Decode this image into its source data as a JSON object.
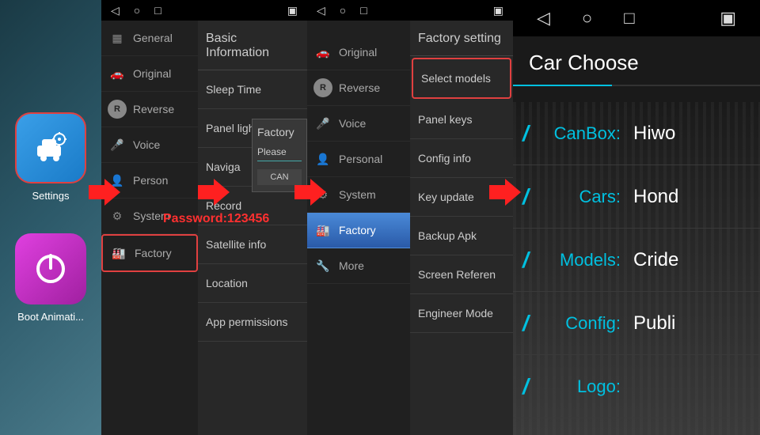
{
  "launcher": {
    "settings_label": "Settings",
    "boot_label": "Boot Animati..."
  },
  "panel2": {
    "sidebar": [
      {
        "key": "general",
        "label": "General"
      },
      {
        "key": "original",
        "label": "Original"
      },
      {
        "key": "reverse",
        "label": "Reverse"
      },
      {
        "key": "voice",
        "label": "Voice"
      },
      {
        "key": "personal",
        "label": "Person"
      },
      {
        "key": "system",
        "label": "System"
      },
      {
        "key": "factory",
        "label": "Factory"
      }
    ],
    "section": "Basic Information",
    "items": [
      "Sleep Time",
      "Panel light setti",
      "Naviga",
      "Record",
      "Satellite info",
      "Location",
      "App permissions"
    ],
    "modal": {
      "title": "Factory",
      "placeholder": "Please",
      "button": "CAN"
    }
  },
  "password_overlay": "Password:123456",
  "panel3": {
    "sidebar": [
      {
        "key": "original",
        "label": "Original"
      },
      {
        "key": "reverse",
        "label": "Reverse"
      },
      {
        "key": "voice",
        "label": "Voice"
      },
      {
        "key": "personal",
        "label": "Personal"
      },
      {
        "key": "system",
        "label": "System"
      },
      {
        "key": "factory",
        "label": "Factory"
      },
      {
        "key": "more",
        "label": "More"
      }
    ],
    "section": "Factory setting",
    "items": [
      "Select models",
      "Panel keys",
      "Config info",
      "Key update",
      "Backup Apk",
      "Screen Referen",
      "Engineer Mode"
    ]
  },
  "panel4": {
    "title": "Car Choose",
    "rows": [
      {
        "label": "CanBox:",
        "value": "Hiwo"
      },
      {
        "label": "Cars:",
        "value": "Hond"
      },
      {
        "label": "Models:",
        "value": "Cride"
      },
      {
        "label": "Config:",
        "value": "Publi"
      },
      {
        "label": "Logo:",
        "value": ""
      }
    ]
  }
}
